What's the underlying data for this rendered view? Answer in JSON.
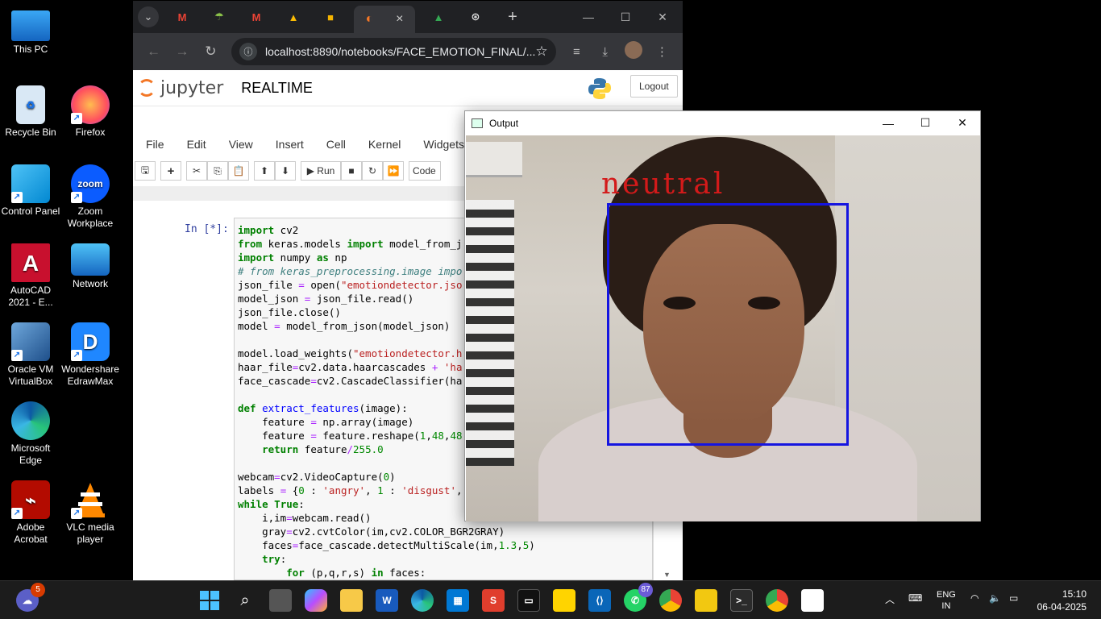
{
  "desktop": {
    "icons": [
      {
        "label": "This PC"
      },
      {
        "label": "Recycle Bin"
      },
      {
        "label": "Firefox"
      },
      {
        "label": "Control Panel"
      },
      {
        "label": "Zoom Workplace"
      },
      {
        "label": "AutoCAD 2021 - E..."
      },
      {
        "label": "Network"
      },
      {
        "label": "Oracle VM VirtualBox"
      },
      {
        "label": "Wondershare EdrawMax"
      },
      {
        "label": "Microsoft Edge"
      },
      {
        "label": "Adobe Acrobat"
      },
      {
        "label": "VLC media player"
      }
    ]
  },
  "browser": {
    "url": "localhost:8890/notebooks/FACE_EMOTION_FINAL/...",
    "new_tab": "+",
    "close_tab": "×"
  },
  "jupyter": {
    "logo_text": "jupyter",
    "notebook_title": "REALTIME",
    "logout_label": "Logout",
    "menu": [
      "File",
      "Edit",
      "View",
      "Insert",
      "Cell",
      "Kernel",
      "Widgets"
    ],
    "run_label": "Run",
    "cell_type": "Code",
    "prompt": "In [*]:"
  },
  "output_window": {
    "title": "Output",
    "emotion_label": "neutral",
    "box_color": "#1515e0",
    "label_color": "#d31a1a"
  },
  "taskbar": {
    "widgets_badge": "5",
    "whatsapp_badge": "87",
    "lang_top": "ENG",
    "lang_bottom": "IN",
    "time": "15:10",
    "date": "06-04-2025"
  }
}
